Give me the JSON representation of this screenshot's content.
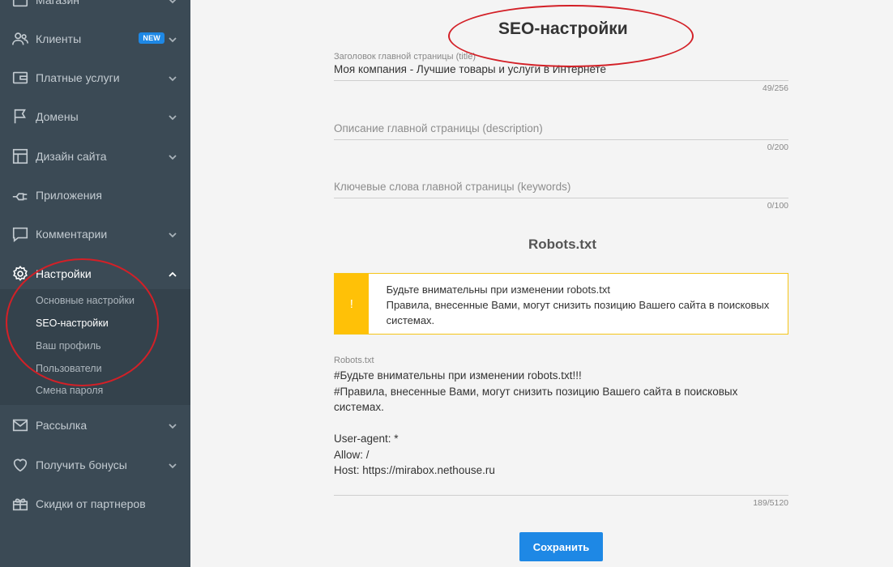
{
  "sidebar": {
    "items": [
      {
        "label": "Магазин",
        "icon": "shop-icon"
      },
      {
        "label": "Клиенты",
        "icon": "users-icon",
        "badge": "NEW"
      },
      {
        "label": "Платные услуги",
        "icon": "wallet-icon"
      },
      {
        "label": "Домены",
        "icon": "flag-icon"
      },
      {
        "label": "Дизайн сайта",
        "icon": "layout-icon"
      },
      {
        "label": "Приложения",
        "icon": "plug-icon"
      },
      {
        "label": "Комментарии",
        "icon": "comment-icon"
      },
      {
        "label": "Настройки",
        "icon": "gear-icon"
      },
      {
        "label": "Рассылка",
        "icon": "mail-icon"
      },
      {
        "label": "Получить бонусы",
        "icon": "heart-icon"
      },
      {
        "label": "Скидки от партнеров",
        "icon": "gift-icon"
      }
    ],
    "submenu": [
      {
        "label": "Основные настройки"
      },
      {
        "label": "SEO-настройки"
      },
      {
        "label": "Ваш профиль"
      },
      {
        "label": "Пользователи"
      },
      {
        "label": "Смена пароля"
      }
    ]
  },
  "main": {
    "title": "SEO-настройки",
    "title_field": {
      "label": "Заголовок главной страницы (title)",
      "value": "Моя компания - Лучшие товары и услуги в Интернете",
      "counter": "49/256"
    },
    "description_field": {
      "placeholder": "Описание главной страницы (description)",
      "counter": "0/200"
    },
    "keywords_field": {
      "placeholder": "Ключевые слова главной страницы (keywords)",
      "counter": "0/100"
    },
    "robots_section_title": "Robots.txt",
    "warning": {
      "icon_glyph": "!",
      "line1": "Будьте внимательны при изменении robots.txt",
      "line2": "Правила, внесенные Вами, могут снизить позицию Вашего сайта в поисковых системах."
    },
    "robots_field": {
      "label": "Robots.txt",
      "content": "#Будьте внимательны при изменении robots.txt!!!\n#Правила, внесенные Вами, могут снизить позицию Вашего сайта в поисковых системах.\n\nUser-agent: *\nAllow: /\nHost: https://mirabox.nethouse.ru",
      "counter": "189/5120"
    },
    "save_label": "Сохранить"
  },
  "colors": {
    "sidebar_bg": "#3b4a55",
    "accent": "#1e88e5",
    "warning": "#ffc107",
    "annotation": "#d32027"
  }
}
